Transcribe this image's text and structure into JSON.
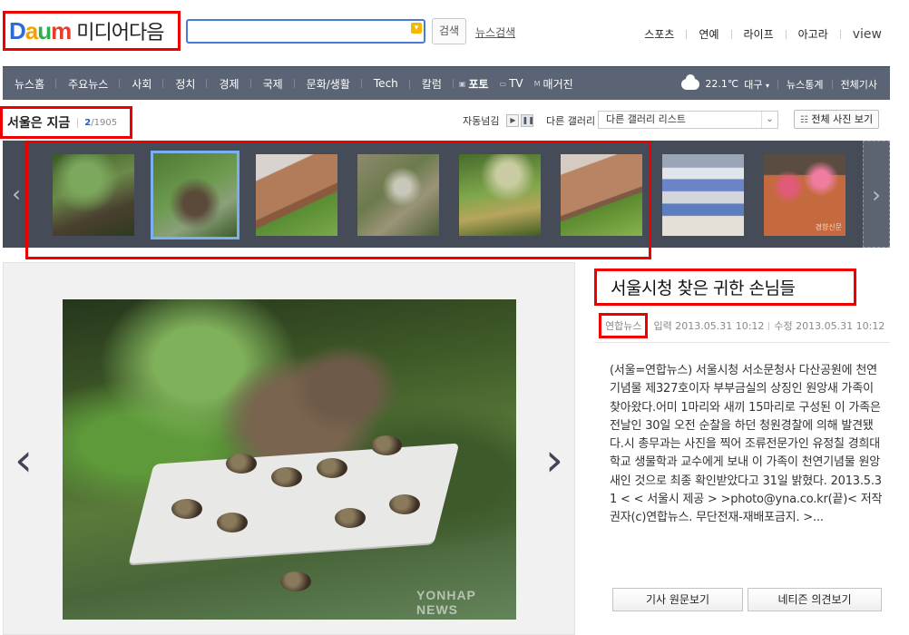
{
  "header": {
    "logo_daum": [
      "D",
      "a",
      "u",
      "m"
    ],
    "logo_media": "미디어다음",
    "search_placeholder": "",
    "search_button": "검색",
    "news_search": "뉴스검색",
    "top_links": [
      "스포츠",
      "연예",
      "라이프",
      "아고라",
      "view"
    ]
  },
  "nav": {
    "items": [
      "뉴스홈",
      "주요뉴스",
      "사회",
      "정치",
      "경제",
      "국제",
      "문화/생활",
      "Tech",
      "칼럼"
    ],
    "media_items": [
      "포토",
      "TV",
      "매거진"
    ],
    "weather": "22.1℃",
    "city": "대구",
    "right_links": [
      "뉴스통계",
      "전체기사"
    ]
  },
  "gallery": {
    "title": "서울은 지금",
    "current": "2",
    "total": "/1905",
    "autoplay_label": "자동넘김",
    "play_glyph": "▶",
    "pause_glyph": "❚❚",
    "other_gallery_label": "다른 갤러리",
    "other_gallery_select": "다른 갤러리 리스트",
    "all_photos_button": "전체 사진 보기",
    "thumb_watermark": "경향신문",
    "selected_index": 1
  },
  "article": {
    "title": "서울시청 찾은 귀한 손님들",
    "source": "연합뉴스",
    "published": "입력 2013.05.31 10:12",
    "modified": "수정 2013.05.31 10:12",
    "body": "(서울=연합뉴스) 서울시청 서소문청사 다산공원에 천연기념물 제327호이자 부부금실의 상징인 원앙새 가족이 찾아왔다.어미 1마리와 새끼 15마리로 구성된 이 가족은 전날인 30일 오전 순찰을 하던 청원경찰에 의해 발견됐다.시 총무과는 사진을 찍어 조류전문가인 유정칠 경희대학교 생물학과 교수에게 보내 이 가족이 천연기념물 원앙새인 것으로 최종 확인받았다고 31일 밝혔다. 2013.5.31 < < 서울시 제공 > >photo@yna.co.kr(끝)< 저작권자(c)연합뉴스. 무단전재-재배포금지. >...",
    "photo_watermark": "YONHAP NEWS",
    "buttons": [
      "기사 원문보기",
      "네티즌 의견보기"
    ]
  },
  "colors": {
    "nav_bg": "#5a6474",
    "strip_bg": "#454c58",
    "highlight_box": "#ee0000",
    "selected_thumb": "#7ab0ef",
    "count_accent": "#1d5ec9"
  },
  "icons": {
    "prev": "chevron-left-icon",
    "next": "chevron-right-icon",
    "weather": "cloud-icon",
    "grid": "grid-icon"
  }
}
